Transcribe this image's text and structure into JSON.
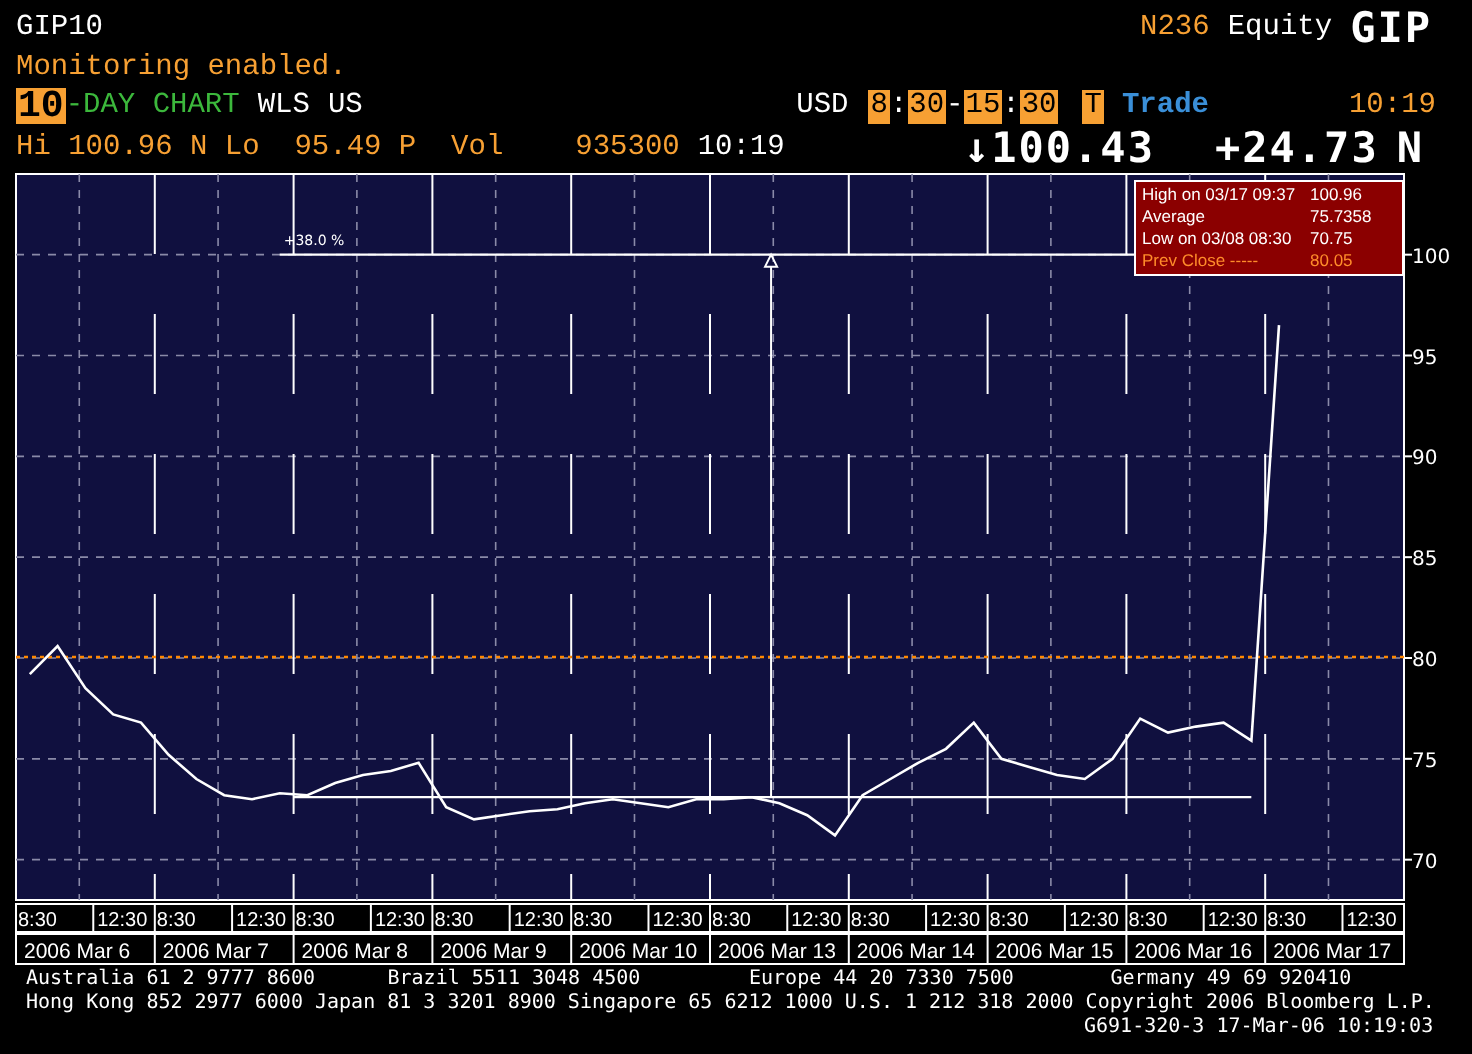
{
  "header": {
    "security": "GIP10",
    "source": "N236",
    "market": "Equity",
    "ticker": "GIP",
    "status": "Monitoring enabled.",
    "chart_days": "10",
    "chart_type": "-DAY CHART",
    "flags": [
      "WLS",
      "US"
    ],
    "currency": "USD",
    "session": [
      {
        "kind": "box",
        "text": "8"
      },
      {
        "kind": "sep",
        "text": ":"
      },
      {
        "kind": "box",
        "text": "30"
      },
      {
        "kind": "sep",
        "text": "-"
      },
      {
        "kind": "box",
        "text": "15"
      },
      {
        "kind": "sep",
        "text": ":"
      },
      {
        "kind": "box",
        "text": "30"
      }
    ],
    "mode_key": "T",
    "mode": "Trade",
    "time": "10:19"
  },
  "quote": {
    "hi_lo": "Hi 100.96 N Lo  95.49 P  Vol",
    "volume": "935300",
    "time": "10:19",
    "last": "↓100.43",
    "change": "+24.73",
    "exchange": "N"
  },
  "chart": {
    "high_line_label": "+38.0 %",
    "stats": [
      {
        "kind": "stat",
        "label": "High on 03/17 09:37",
        "value": "100.96"
      },
      {
        "kind": "stat",
        "label": "Average",
        "value": "75.7358"
      },
      {
        "kind": "stat",
        "label": "Low on 03/08 08:30",
        "value": "70.75"
      },
      {
        "kind": "prev_close",
        "label": "Prev Close -----",
        "value": "80.05"
      }
    ],
    "dates": [
      "2006 Mar 6",
      "2006 Mar 7",
      "2006 Mar 8",
      "2006 Mar 9",
      "2006 Mar 10",
      "2006 Mar 13",
      "2006 Mar 14",
      "2006 Mar 15",
      "2006 Mar 16",
      "2006 Mar 17"
    ],
    "chart_data": {
      "type": "line",
      "ylim": [
        68,
        104
      ],
      "grid": true,
      "ref_lines": [
        {
          "axis": "y",
          "value": 80.05,
          "color": "#ff8800"
        },
        {
          "axis": "y",
          "value": 100,
          "color": "#ffffff"
        },
        {
          "axis": "y",
          "value": 73.1,
          "color": "#ffffff"
        }
      ],
      "categories": [
        "8:30",
        null,
        null,
        "12:30",
        null,
        "8:30",
        null,
        null,
        "12:30",
        null,
        "8:30",
        null,
        null,
        "12:30",
        null,
        "8:30",
        null,
        null,
        "12:30",
        null,
        "8:30",
        null,
        null,
        "12:30",
        null,
        "8:30",
        null,
        null,
        "12:30",
        null,
        "8:30",
        null,
        null,
        "12:30",
        null,
        "8:30",
        null,
        null,
        "12:30",
        null,
        "8:30",
        null,
        null,
        "12:30",
        null,
        "8:30",
        null,
        null,
        "12:30",
        null
      ],
      "values": [
        79.2,
        80.6,
        78.5,
        77.2,
        76.8,
        75.2,
        74.0,
        73.2,
        73.0,
        73.3,
        73.2,
        73.8,
        74.2,
        74.4,
        74.8,
        72.6,
        72.0,
        72.2,
        72.4,
        72.5,
        72.8,
        73.0,
        72.8,
        72.6,
        73.0,
        73.0,
        73.1,
        72.8,
        72.2,
        71.2,
        73.2,
        74.0,
        74.8,
        75.5,
        76.8,
        75.0,
        74.6,
        74.2,
        74.0,
        75.0,
        77.0,
        76.3,
        76.6,
        76.8,
        75.9,
        96.5,
        null,
        null,
        null,
        null
      ],
      "yticks": [
        70,
        75,
        80,
        85,
        90,
        95,
        100
      ]
    }
  },
  "footer": {
    "offices": [
      "Australia 61 2 9777 8600",
      "Brazil 5511 3048 4500",
      "Europe 44 20 7330 7500",
      "Germany 49 69 920410"
    ],
    "line_2": "Hong Kong 852 2977 6000 Japan 81 3 3201 8900 Singapore 65 6212 1000 U.S. 1 212 318 2000 Copyright 2006 Bloomberg L.P.",
    "line_3": "G691-320-3 17-Mar-06 10:19:03"
  }
}
